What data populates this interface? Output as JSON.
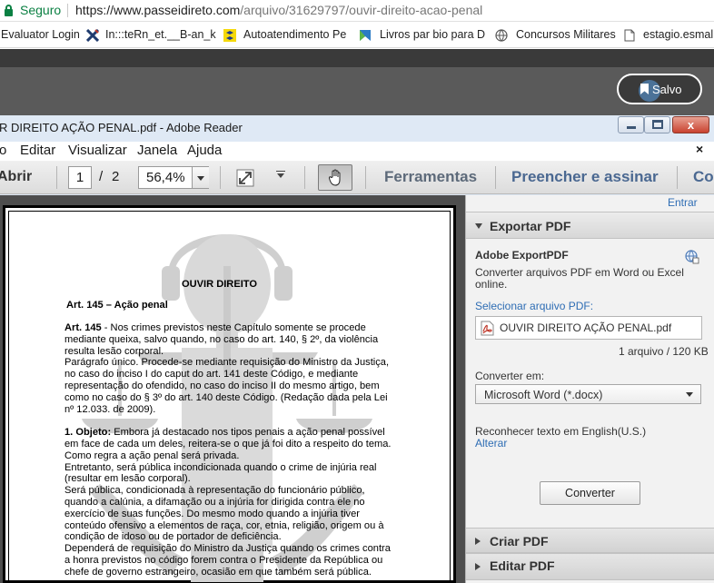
{
  "browser": {
    "secure_label": "Seguro",
    "url_host": "https://www.passeidireto.com",
    "url_path": "/arquivo/31629797/ouvir-direito-acao-penal"
  },
  "bookmarks": [
    {
      "label": "Evaluator Login",
      "icon": "none"
    },
    {
      "label": "In:::teRn_et.__B-an_k",
      "icon": "x-icon"
    },
    {
      "label": "Autoatendimento Pe",
      "icon": "bb-icon"
    },
    {
      "label": "Livros par bio para D",
      "icon": "bookmark-flag-icon"
    },
    {
      "label": "Concursos Militares",
      "icon": "globe-icon"
    },
    {
      "label": "estagio.esmal.t",
      "icon": "page-icon"
    }
  ],
  "site": {
    "saved_button": "Salvo"
  },
  "reader": {
    "title": "R DIREITO AÇÃO PENAL.pdf - Adobe Reader",
    "menu": [
      "o",
      "Editar",
      "Visualizar",
      "Janela",
      "Ajuda"
    ],
    "close_x": "×",
    "toolbar": {
      "open_label": "Abrir",
      "page_current": "1",
      "page_separator": "/",
      "page_total": "2",
      "zoom": "56,4%",
      "tab_tools": "Ferramentas",
      "tab_fill_sign": "Preencher e assinar",
      "tab_comment": "Co"
    },
    "window_close": "x"
  },
  "document": {
    "title": "OUVIR DIREITO",
    "subtitle": "Art. 145 – Ação penal",
    "lines": [
      {
        "bold": "Art. 145",
        "text": " - Nos crimes previstos neste Capítulo somente se procede"
      },
      {
        "bold": "",
        "text": "mediante queixa, salvo quando, no caso do art. 140, § 2º, da violência"
      },
      {
        "bold": "",
        "text": "resulta lesão corporal."
      },
      {
        "bold": "",
        "text": "Parágrafo único. Procede-se mediante requisição do Ministro da Justiça,"
      },
      {
        "bold": "",
        "text": "no caso do inciso I do caput do art. 141 deste Código, e mediante"
      },
      {
        "bold": "",
        "text": "representação do ofendido, no caso do inciso II do mesmo artigo, bem"
      },
      {
        "bold": "",
        "text": "como no caso do § 3º do art. 140 deste Código. (Redação dada pela Lei"
      },
      {
        "bold": "",
        "text": "nº 12.033. de 2009)."
      },
      {
        "bold": "",
        "text": ""
      },
      {
        "bold": "1. Objeto:",
        "text": " Embora já destacado nos tipos penais a ação penal possível"
      },
      {
        "bold": "",
        "text": "em face de cada um deles, reitera-se o que já foi dito a respeito do tema."
      },
      {
        "bold": "",
        "text": "Como regra a ação penal será privada."
      },
      {
        "bold": "",
        "text": "Entretanto, será pública incondicionada quando o crime de injúria real"
      },
      {
        "bold": "",
        "text": "(resultar em lesão corporal)."
      },
      {
        "bold": "",
        "text": "Será pública, condicionada à representação do funcionário público,"
      },
      {
        "bold": "",
        "text": "quando a calúnia, a difamação ou a injúria for dirigida contra ele no"
      },
      {
        "bold": "",
        "text": "exercício de suas funções. Do mesmo modo quando a injúria tiver"
      },
      {
        "bold": "",
        "text": "conteúdo ofensivo a elementos de raça, cor, etnia, religião, origem ou à"
      },
      {
        "bold": "",
        "text": "condição de idoso ou de portador de deficiência."
      },
      {
        "bold": "",
        "text": "Dependerá de requisição do Ministro da Justiça quando os crimes contra"
      },
      {
        "bold": "",
        "text": "a honra previstos no código forem contra o Presidente da República ou"
      },
      {
        "bold": "",
        "text": "chefe de governo estrangeiro, ocasião em que também será pública."
      }
    ]
  },
  "pane": {
    "login": "Entrar",
    "export_header": "Exportar PDF",
    "service_name": "Adobe ExportPDF",
    "service_desc_1": "Converter arquivos PDF em Word ou Excel",
    "service_desc_2": "online.",
    "select_label": "Selecionar arquivo PDF:",
    "file_name": "OUVIR DIREITO AÇÃO PENAL.pdf",
    "file_info": "1 arquivo / 120 KB",
    "convert_to_label": "Converter em:",
    "convert_to_value": "Microsoft Word (*.docx)",
    "ocr_label": "Reconhecer texto em English(U.S.)",
    "change_link": "Alterar",
    "convert_button": "Converter",
    "create_header": "Criar PDF",
    "edit_header": "Editar PDF"
  }
}
